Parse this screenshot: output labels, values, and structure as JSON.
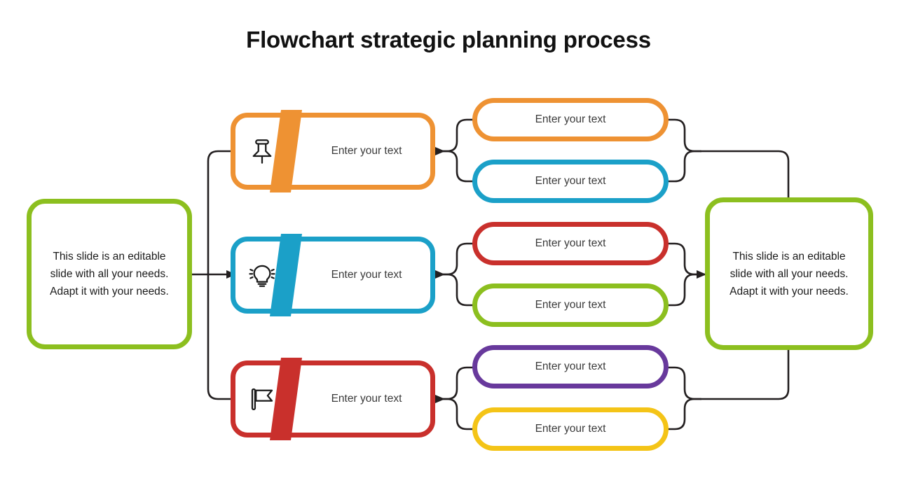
{
  "slide": {
    "title": "Flowchart strategic planning process",
    "background": "#FFFFFF"
  },
  "colors": {
    "orange": "#EE9233",
    "blue": "#1BA0C8",
    "red": "#C9302C",
    "green": "#8CBF1F",
    "purple": "#68399C",
    "yellow": "#F4C417",
    "connector": "#231F20",
    "body_text": "#1A1A1A",
    "pill_text": "#3A3A3A",
    "title_text": "#111111"
  },
  "side_boxes": {
    "left": {
      "text": "This slide is an editable slide with all your needs. Adapt it with your needs.",
      "line1": "This slide is an editable",
      "line2": "slide with all your  needs.",
      "line3": "Adapt it with your  needs.",
      "color": "#8CBF1F"
    },
    "right": {
      "text": "This slide is an editable slide with all your needs. Adapt it with your needs.",
      "line1": "This slide is an editable",
      "line2": "slide with all your  needs.",
      "line3": "Adapt it with your  needs.",
      "color": "#8CBF1F"
    }
  },
  "stages": [
    {
      "label": "Enter your text",
      "color": "#EE9233",
      "icon": "pushpin-icon"
    },
    {
      "label": "Enter your text",
      "color": "#1BA0C8",
      "icon": "lightbulb-icon"
    },
    {
      "label": "Enter your text",
      "color": "#C9302C",
      "icon": "flag-icon"
    }
  ],
  "pills": [
    {
      "label": "Enter your text",
      "color": "#EE9233"
    },
    {
      "label": "Enter your text",
      "color": "#1BA0C8"
    },
    {
      "label": "Enter your text",
      "color": "#C9302C"
    },
    {
      "label": "Enter your text",
      "color": "#8CBF1F"
    },
    {
      "label": "Enter your text",
      "color": "#68399C"
    },
    {
      "label": "Enter your text",
      "color": "#F4C417"
    }
  ]
}
